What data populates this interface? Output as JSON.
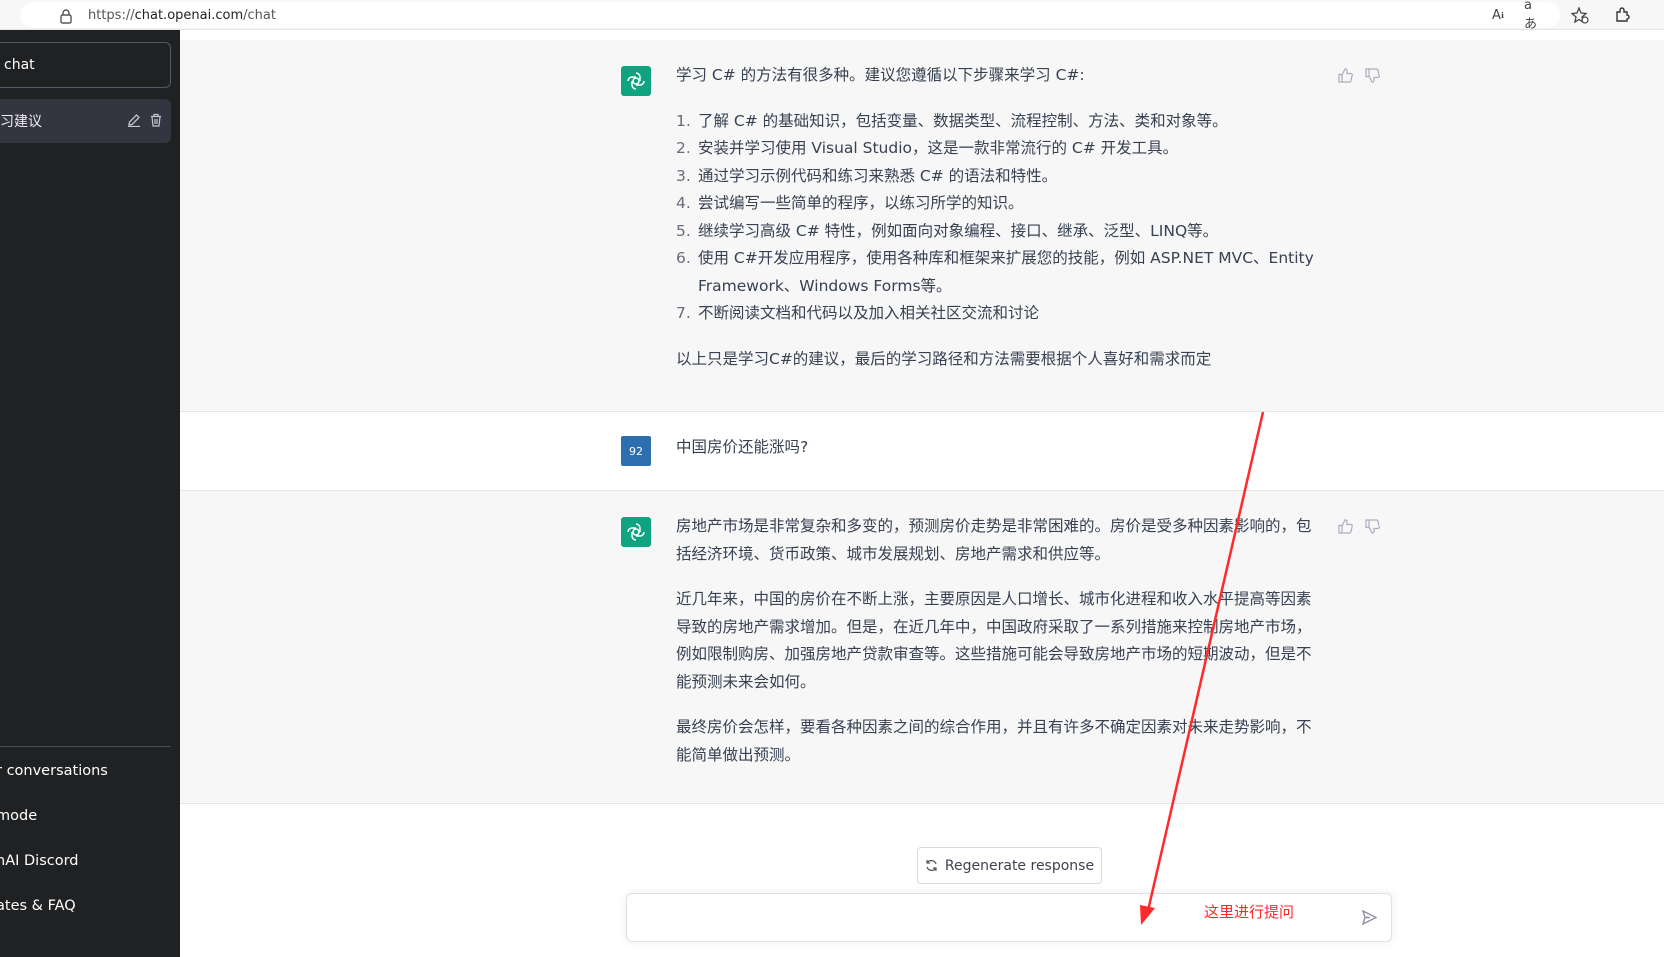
{
  "browser": {
    "url_prefix": "https://",
    "url_host": "chat.openai.com",
    "url_path": "/chat",
    "icons": [
      "read-aloud-icon",
      "translate-icon",
      "favorites-icon",
      "extensions-icon"
    ]
  },
  "sidebar": {
    "new_chat_label": "chat",
    "history": [
      {
        "title": "习建议"
      }
    ],
    "links": [
      {
        "label": "r conversations",
        "icon": "trash-icon"
      },
      {
        "label": " mode",
        "icon": "moon-icon"
      },
      {
        "label": "nAI Discord",
        "icon": "discord-icon"
      },
      {
        "label": "ates & FAQ",
        "icon": "external-link-icon"
      }
    ]
  },
  "conversation": {
    "user_avatar_label": "92",
    "msg1": {
      "intro": "学习 C# 的方法有很多种。建议您遵循以下步骤来学习 C#:",
      "steps": [
        {
          "num": "1.",
          "text": "了解 C# 的基础知识，包括变量、数据类型、流程控制、方法、类和对象等。"
        },
        {
          "num": "2.",
          "text": "安装并学习使用 Visual Studio，这是一款非常流行的 C# 开发工具。"
        },
        {
          "num": "3.",
          "text": "通过学习示例代码和练习来熟悉 C# 的语法和特性。"
        },
        {
          "num": "4.",
          "text": "尝试编写一些简单的程序，以练习所学的知识。"
        },
        {
          "num": "5.",
          "text": "继续学习高级 C# 特性，例如面向对象编程、接口、继承、泛型、LINQ等。"
        },
        {
          "num": "6.",
          "text": "使用 C#开发应用程序，使用各种库和框架来扩展您的技能，例如 ASP.NET MVC、Entity Framework、Windows Forms等。"
        },
        {
          "num": "7.",
          "text": "不断阅读文档和代码以及加入相关社区交流和讨论"
        }
      ],
      "outro": "以上只是学习C#的建议，最后的学习路径和方法需要根据个人喜好和需求而定"
    },
    "user_question": "中国房价还能涨吗?",
    "msg2": {
      "p1": "房地产市场是非常复杂和多变的，预测房价走势是非常困难的。房价是受多种因素影响的，包括经济环境、货币政策、城市发展规划、房地产需求和供应等。",
      "p2": "近几年来，中国的房价在不断上涨，主要原因是人口增长、城市化进程和收入水平提高等因素导致的房地产需求增加。但是，在近几年中，中国政府采取了一系列措施来控制房地产市场，例如限制购房、加强房地产贷款审查等。这些措施可能会导致房地产市场的短期波动，但是不能预测未来会如何。",
      "p3": "最终房价会怎样，要看各种因素之间的综合作用，并且有许多不确定因素对未来走势影响，不能简单做出预测。"
    }
  },
  "regenerate_label": "Regenerate response",
  "input": {
    "value": "",
    "placeholder": ""
  },
  "annotation": {
    "text": "这里进行提问",
    "color": "#ff2a2a"
  },
  "colors": {
    "sidebar_bg": "#202123",
    "assistant_bg": "#f7f7f8",
    "brand_green": "#10a37f",
    "user_avatar": "#2d6fae"
  }
}
